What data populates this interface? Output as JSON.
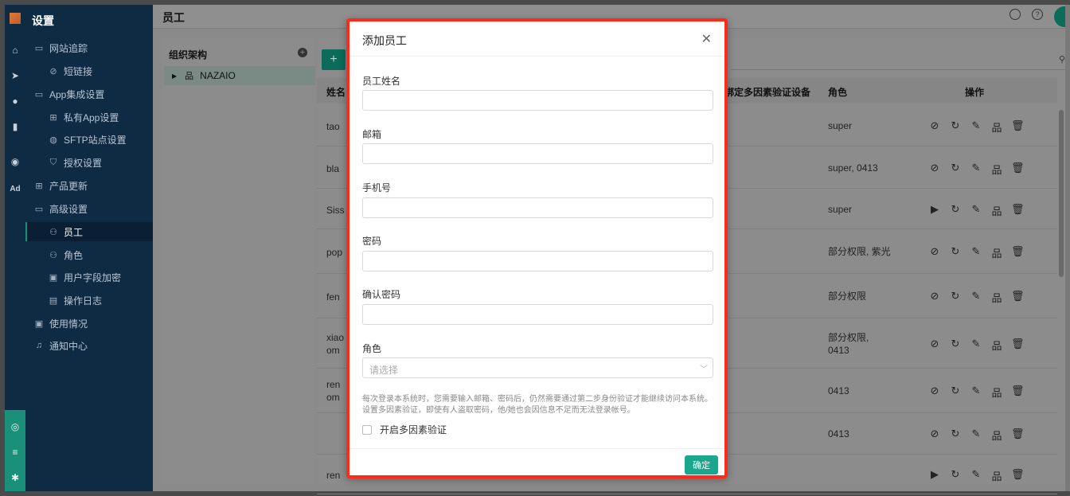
{
  "sidebar": {
    "title": "设置",
    "items": [
      {
        "label": "网站追踪",
        "icon": "folder-icon",
        "level": 1
      },
      {
        "label": "短链接",
        "icon": "link-icon",
        "level": 2
      },
      {
        "label": "App集成设置",
        "icon": "folder-icon",
        "level": 1
      },
      {
        "label": "私有App设置",
        "icon": "apps-icon",
        "level": 2
      },
      {
        "label": "SFTP站点设置",
        "icon": "globe-icon",
        "level": 2
      },
      {
        "label": "授权设置",
        "icon": "shield-icon",
        "level": 2
      },
      {
        "label": "产品更新",
        "icon": "grid-icon",
        "level": 1
      },
      {
        "label": "高级设置",
        "icon": "folder-icon",
        "level": 1
      },
      {
        "label": "员工",
        "icon": "user-icon",
        "level": 2,
        "active": true
      },
      {
        "label": "角色",
        "icon": "user-role-icon",
        "level": 2
      },
      {
        "label": "用户字段加密",
        "icon": "lock-doc-icon",
        "level": 2
      },
      {
        "label": "操作日志",
        "icon": "log-icon",
        "level": 2
      },
      {
        "label": "使用情况",
        "icon": "usage-icon",
        "level": 1
      },
      {
        "label": "通知中心",
        "icon": "bell-icon",
        "level": 1
      }
    ]
  },
  "rail": {
    "items": [
      "home-icon",
      "send-icon",
      "user-icon",
      "chart-icon",
      "wechat-icon"
    ],
    "ad_label": "Ad"
  },
  "main": {
    "title": "员工",
    "org": {
      "header": "组织架构",
      "node": "NAZAIO"
    },
    "table": {
      "headers": {
        "name": "姓名",
        "mfa": "绑定多因素验证设备",
        "role": "角色",
        "ops": "操作"
      },
      "rows": [
        {
          "name": "tao",
          "role": "super",
          "first_op": "ban"
        },
        {
          "name": "bla",
          "role": "super, 0413",
          "first_op": "ban"
        },
        {
          "name": "Siss",
          "role": "super",
          "first_op": "play"
        },
        {
          "name": "pop",
          "role": "部分权限, 紫光",
          "first_op": "ban"
        },
        {
          "name": "fen",
          "role": "部分权限",
          "first_op": "ban"
        },
        {
          "name": "xiao\nom",
          "role": "部分权限,\n0413",
          "first_op": "ban"
        },
        {
          "name": "ren\nom",
          "role": "0413",
          "first_op": "ban"
        },
        {
          "name": "",
          "role": "0413",
          "first_op": "ban"
        },
        {
          "name": "ren",
          "role": "",
          "first_op": "play"
        }
      ]
    }
  },
  "modal": {
    "title": "添加员工",
    "fields": {
      "name_label": "员工姓名",
      "email_label": "邮箱",
      "phone_label": "手机号",
      "password_label": "密码",
      "confirm_label": "确认密码",
      "role_label": "角色",
      "role_placeholder": "请选择"
    },
    "note": "每次登录本系统时，您需要输入邮箱、密码后，仍然需要通过第二步身份验证才能继续访问本系统。设置多因素验证，即使有人盗取密码，他/她也会因信息不足而无法登录帐号。",
    "mfa_checkbox_label": "开启多因素验证",
    "ok_label": "确定"
  }
}
